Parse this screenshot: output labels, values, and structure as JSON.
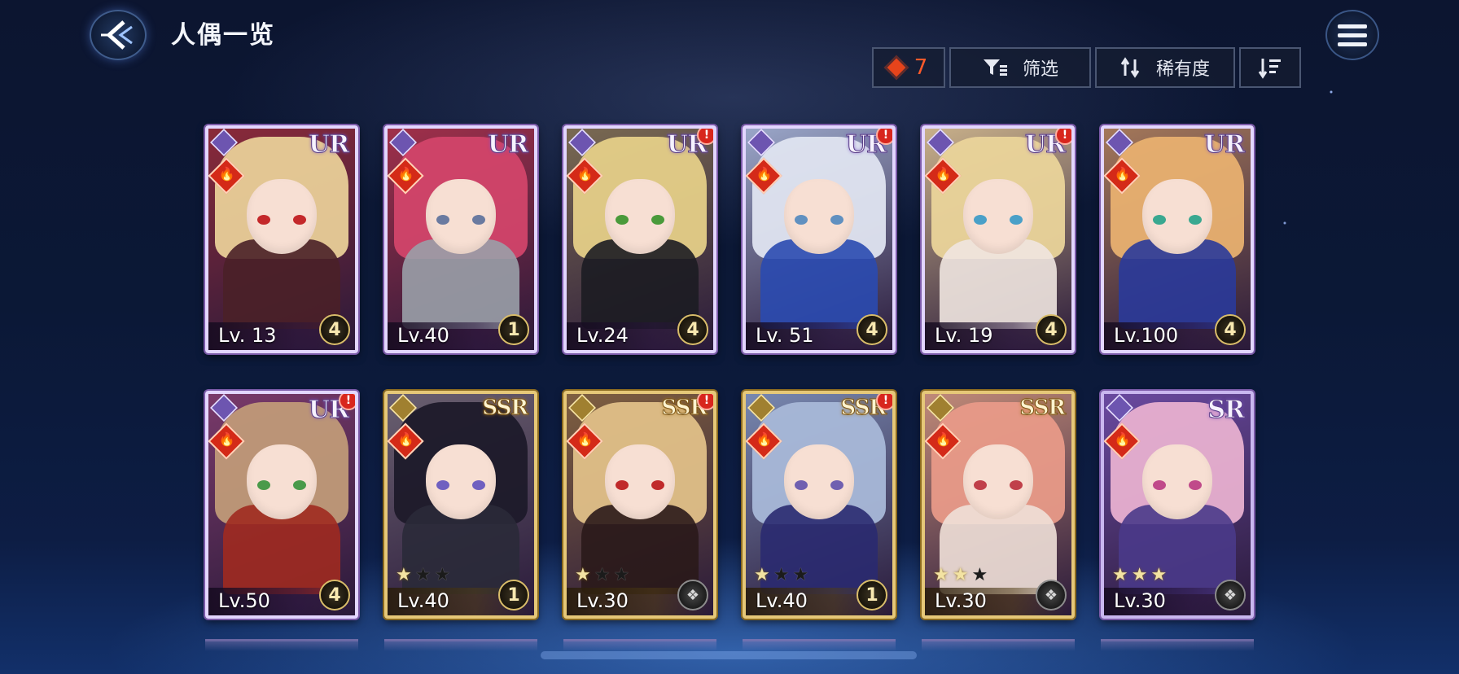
{
  "header": {
    "title": "人偶一览"
  },
  "toolbar": {
    "gem_count": "7",
    "filter_label": "筛选",
    "rarity_label": "稀有度"
  },
  "cards": [
    {
      "rarity": "UR",
      "level": "Lv. 13",
      "rank": "4",
      "alert": false,
      "hair": "#e9cf98",
      "eye": "#c4282a",
      "outfit": "#4a2028",
      "bg": "#8a2a3a"
    },
    {
      "rarity": "UR",
      "level": "Lv.40",
      "rank": "1",
      "alert": false,
      "hair": "#d2456a",
      "eye": "#6a7aa0",
      "outfit": "#9aa0a8",
      "bg": "#a0304a"
    },
    {
      "rarity": "UR",
      "level": "Lv.24",
      "rank": "4",
      "alert": true,
      "hair": "#e5cf88",
      "eye": "#4a9a3a",
      "outfit": "#1c1c22",
      "bg": "#7a6a52"
    },
    {
      "rarity": "UR",
      "level": "Lv. 51",
      "rank": "4",
      "alert": true,
      "hair": "#dfe4f0",
      "eye": "#6090c0",
      "outfit": "#2a4ab0",
      "bg": "#9aa6c8"
    },
    {
      "rarity": "UR",
      "level": "Lv. 19",
      "rank": "4",
      "alert": true,
      "hair": "#ead49a",
      "eye": "#4aa0c8",
      "outfit": "#f0e6e0",
      "bg": "#c8b08a"
    },
    {
      "rarity": "UR",
      "level": "Lv.100",
      "rank": "4",
      "alert": false,
      "hair": "#e8b070",
      "eye": "#3aa890",
      "outfit": "#2a3a9a",
      "bg": "#a4785a"
    },
    {
      "rarity": "UR",
      "level": "Lv.50",
      "rank": "4",
      "alert": true,
      "hair": "#c09a78",
      "eye": "#4a9a4a",
      "outfit": "#a02a20",
      "bg": "#7a3a6a"
    },
    {
      "rarity": "SSR",
      "level": "Lv.40",
      "rank": "1",
      "alert": false,
      "hair": "#1e1a2a",
      "eye": "#7060c0",
      "outfit": "#2a2a38",
      "bg": "#6a6070",
      "stars": 1
    },
    {
      "rarity": "SSR",
      "level": "Lv.30",
      "rank": "",
      "alert": true,
      "hair": "#e0c088",
      "eye": "#c02a2a",
      "outfit": "#2a1a1a",
      "bg": "#806040",
      "stars": 1
    },
    {
      "rarity": "SSR",
      "level": "Lv.40",
      "rank": "1",
      "alert": true,
      "hair": "#a8b8d8",
      "eye": "#7060b0",
      "outfit": "#2a2a70",
      "bg": "#7888b0",
      "stars": 1
    },
    {
      "rarity": "SSR",
      "level": "Lv.30",
      "rank": "",
      "alert": false,
      "hair": "#e89a88",
      "eye": "#c0404a",
      "outfit": "#f0e0d8",
      "bg": "#c08a78",
      "stars": 2
    },
    {
      "rarity": "SR",
      "level": "Lv.30",
      "rank": "",
      "alert": false,
      "hair": "#e8b0d0",
      "eye": "#c04a8a",
      "outfit": "#4a3a8a",
      "bg": "#6a4aa0",
      "stars": 3
    }
  ]
}
